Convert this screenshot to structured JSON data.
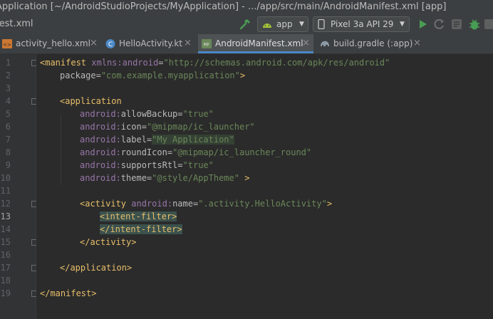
{
  "window": {
    "title": "Application [~/AndroidStudioProjects/MyApplication] - .../app/src/main/AndroidManifest.xml [app]"
  },
  "navbar": {
    "breadcrumb_file": "fest.xml",
    "run_config": "app",
    "device": "Pixel 3a API 29"
  },
  "tabs": [
    {
      "label": "activity_hello.xml",
      "icon": "xml-file-icon",
      "active": false
    },
    {
      "label": "HelloActivity.kt",
      "icon": "kotlin-file-icon",
      "active": false
    },
    {
      "label": "AndroidManifest.xml",
      "icon": "manifest-file-icon",
      "active": true
    },
    {
      "label": "build.gradle (:app)",
      "icon": "gradle-file-icon",
      "active": false
    }
  ],
  "editor": {
    "current_line": 13,
    "lines": [
      {
        "n": "1"
      },
      {
        "n": "2"
      },
      {
        "n": "3"
      },
      {
        "n": "4"
      },
      {
        "n": "5"
      },
      {
        "n": "6"
      },
      {
        "n": "7"
      },
      {
        "n": "8"
      },
      {
        "n": "9"
      },
      {
        "n": "10"
      },
      {
        "n": "11"
      },
      {
        "n": "12"
      },
      {
        "n": "13"
      },
      {
        "n": "14"
      },
      {
        "n": "15"
      },
      {
        "n": "16"
      },
      {
        "n": "17"
      },
      {
        "n": "18"
      },
      {
        "n": "19"
      }
    ],
    "code": {
      "l1_open": "<manifest",
      "l1_ns": "xmlns:",
      "l1_attr": "android",
      "l1_eq": "=",
      "l1_val": "\"http://schemas.android.com/apk/res/android\"",
      "l2_attr": "package",
      "l2_eq": "=",
      "l2_val": "\"com.example.myapplication\"",
      "l2_close": ">",
      "l4_open": "<application",
      "l5_ns": "android:",
      "l5_attr": "allowBackup",
      "l5_eq": "=",
      "l5_val": "\"true\"",
      "l6_ns": "android:",
      "l6_attr": "icon",
      "l6_eq": "=",
      "l6_val": "\"@mipmap/ic_launcher\"",
      "l7_ns": "android:",
      "l7_attr": "label",
      "l7_eq": "=",
      "l7_val": "\"My Application\"",
      "l8_ns": "android:",
      "l8_attr": "roundIcon",
      "l8_eq": "=",
      "l8_val": "\"@mipmap/ic_launcher_round\"",
      "l9_ns": "android:",
      "l9_attr": "supportsRtl",
      "l9_eq": "=",
      "l9_val": "\"true\"",
      "l10_ns": "android:",
      "l10_attr": "theme",
      "l10_eq": "=",
      "l10_val": "\"@style/AppTheme\"",
      "l10_close": " >",
      "l12_open": "<activity",
      "l12_ns": "android:",
      "l12_attr": "name",
      "l12_eq": "=",
      "l12_val": "\".activity.HelloActivity\"",
      "l12_close": ">",
      "l13_tag": "<intent-filter>",
      "l14_tag": "</intent-filter>",
      "l15_tag": "</activity>",
      "l17_tag": "</application>",
      "l19_tag": "</manifest>"
    }
  },
  "colors": {
    "background": "#2b2b2b",
    "tag": "#e8bf6a",
    "namespace": "#9876aa",
    "attribute": "#bababa",
    "value": "#6a8759",
    "run_green": "#499c54",
    "accent_blue": "#4a88c7"
  }
}
